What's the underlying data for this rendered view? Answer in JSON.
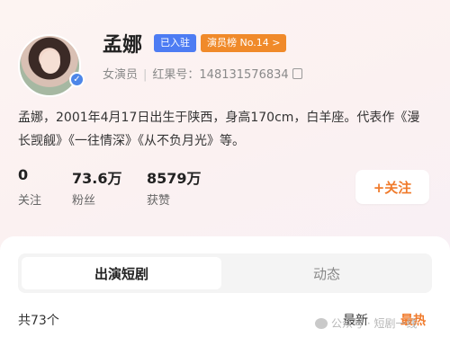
{
  "profile": {
    "name": "孟娜",
    "badge_joined": "已入驻",
    "badge_rank": "演员榜 No.14 >",
    "role": "女演员",
    "id_label": "红果号：148131576834",
    "bio": "孟娜，2001年4月17日出生于陕西，身高170cm，白羊座。代表作《漫长觊觎》《一往情深》《从不负月光》等。"
  },
  "stats": [
    {
      "value": "0",
      "label": "关注"
    },
    {
      "value": "73.6万",
      "label": "粉丝"
    },
    {
      "value": "8579万",
      "label": "获赞"
    }
  ],
  "actions": {
    "follow_label": "+关注"
  },
  "tabs": [
    {
      "label": "出演短剧"
    },
    {
      "label": "动态"
    }
  ],
  "list": {
    "count_label": "共73个",
    "sort_latest": "最新",
    "sort_hot": "最热"
  },
  "watermark": "公众号 · 短剧一线",
  "colors": {
    "accent": "#f07a2b",
    "badge_blue": "#4d7cf3",
    "verify_blue": "#4d86e8"
  }
}
